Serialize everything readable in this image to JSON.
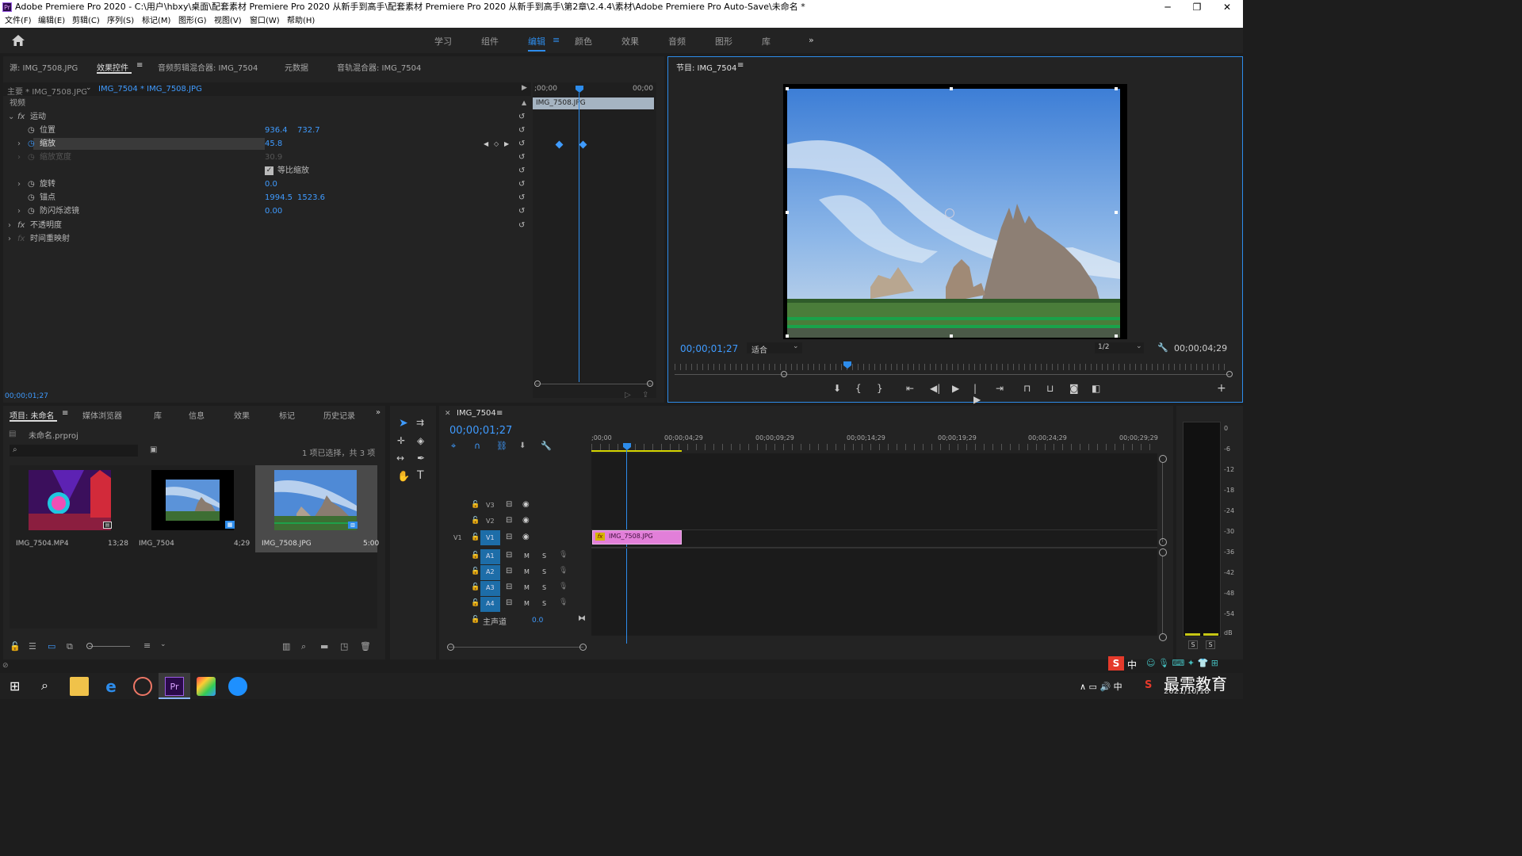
{
  "window": {
    "title": "Adobe Premiere Pro 2020 - C:\\用户\\hbxy\\桌面\\配套素材 Premiere Pro 2020 从新手到高手\\配套素材 Premiere Pro 2020 从新手到高手\\第2章\\2.4.4\\素材\\Adobe Premiere Pro Auto-Save\\未命名 *",
    "logo": "Pr",
    "min": "─",
    "max": "❐",
    "close": "✕"
  },
  "menu": [
    "文件(F)",
    "编辑(E)",
    "剪辑(C)",
    "序列(S)",
    "标记(M)",
    "图形(G)",
    "视图(V)",
    "窗口(W)",
    "帮助(H)"
  ],
  "workspaces": [
    "学习",
    "组件",
    "编辑",
    "颜色",
    "效果",
    "音频",
    "图形",
    "库"
  ],
  "workspace_active_index": 2,
  "workspace_more": "»",
  "source_panel": {
    "tabs": [
      "源: IMG_7508.JPG",
      "效果控件",
      "音频剪辑混合器: IMG_7504",
      "元数据",
      "音轨混合器: IMG_7504"
    ],
    "active_tab": "效果控件",
    "menu_icon": "≡",
    "master_label": "主要 * IMG_7508.JPG",
    "clip_label": "IMG_7504 * IMG_7508.JPG",
    "tl_start": ";00;00",
    "tl_end": "00;00",
    "clip_bar": "IMG_7508.JPG",
    "video_label": "视频",
    "fx_sections": {
      "motion": "运动",
      "position": "位置",
      "position_x": "936.4",
      "position_y": "732.7",
      "scale": "缩放",
      "scale_val": "45.8",
      "scale_width": "缩放宽度",
      "scale_width_val": "30.9",
      "uniform": "等比缩放",
      "rotation": "旋转",
      "rotation_val": "0.0",
      "anchor": "锚点",
      "anchor_x": "1994.5",
      "anchor_y": "1523.6",
      "flicker": "防闪烁滤镜",
      "flicker_val": "0.00",
      "opacity": "不透明度",
      "time_remap": "时间重映射"
    },
    "timecode": "00;00;01;27"
  },
  "program": {
    "title": "节目: IMG_7504",
    "timecode": "00;00;01;27",
    "fit": "适合",
    "res": "1/2",
    "duration": "00;00;04;29"
  },
  "project": {
    "tabs": [
      "项目: 未命名",
      "媒体浏览器",
      "库",
      "信息",
      "效果",
      "标记",
      "历史记录"
    ],
    "file": "未命名.prproj",
    "selection": "1 项已选择，共 3 项",
    "items": [
      {
        "name": "IMG_7504.MP4",
        "dur": "13;28"
      },
      {
        "name": "IMG_7504",
        "dur": "4;29"
      },
      {
        "name": "IMG_7508.JPG",
        "dur": "5:00"
      }
    ]
  },
  "timeline": {
    "title": "IMG_7504",
    "timecode": "00;00;01;27",
    "ruler": [
      ";00;00",
      "00;00;04;29",
      "00;00;09;29",
      "00;00;14;29",
      "00;00;19;29",
      "00;00;24;29",
      "00;00;29;29"
    ],
    "tracks": [
      "V3",
      "V2",
      "V1",
      "A1",
      "A2",
      "A3",
      "A4"
    ],
    "v1_src": "V1",
    "clip": "IMG_7508.JPG",
    "clip_fx": "fx",
    "master": "主声道",
    "master_val": "0.0",
    "m": "M",
    "s": "S"
  },
  "meter": {
    "scale": [
      "0",
      "-6",
      "-12",
      "-18",
      "-24",
      "-30",
      "-36",
      "-42",
      "-48",
      "-54",
      "dB"
    ],
    "s1": "S",
    "s2": "S"
  },
  "taskbar": {
    "date": "2021/10/18",
    "watermark": "最需教育",
    "ime": "中"
  }
}
